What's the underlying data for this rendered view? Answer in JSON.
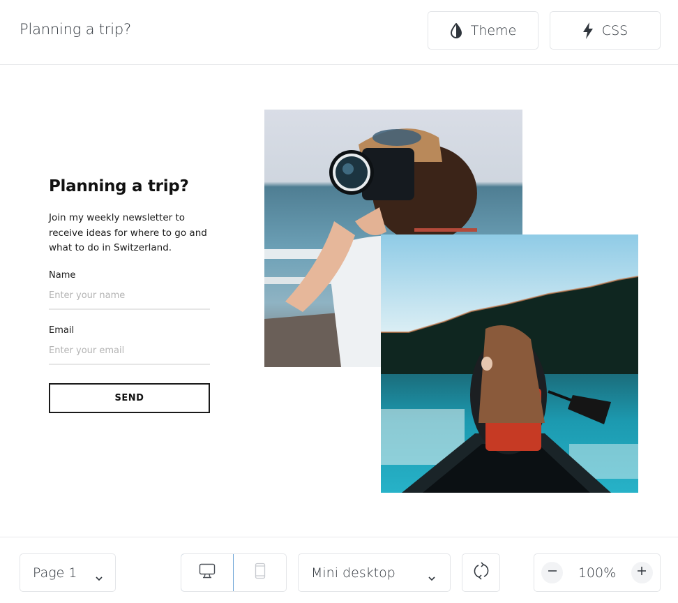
{
  "topbar": {
    "title": "Planning a trip?",
    "buttons": [
      {
        "label": "Theme",
        "icon": "droplet-half-icon"
      },
      {
        "label": "CSS",
        "icon": "lightning-bolt-icon"
      }
    ]
  },
  "canvas": {
    "form": {
      "heading": "Planning a trip?",
      "description": "Join my weekly newsletter to receive ideas for where to go and what to do in Switzerland.",
      "fields": [
        {
          "label": "Name",
          "placeholder": "Enter your name",
          "value": ""
        },
        {
          "label": "Email",
          "placeholder": "Enter your email",
          "value": ""
        }
      ],
      "submit_label": "SEND"
    },
    "photos": [
      {
        "alt": "Person with cap photographing with a camera by a lake"
      },
      {
        "alt": "Woman in red life vest paddling a canoe on a turquoise lake"
      }
    ]
  },
  "bottombar": {
    "page_select": {
      "selected": "Page 1"
    },
    "device_toggle": {
      "options": [
        "desktop",
        "mobile"
      ],
      "active": "desktop"
    },
    "viewport_select": {
      "selected": "Mini desktop"
    },
    "rotate_icon": "rotate-icon",
    "zoom": {
      "value": "100%",
      "decrease_icon": "minus-icon",
      "increase_icon": "plus-icon"
    }
  },
  "colors": {
    "border": "#e3e5e8",
    "active_border": "#6aa3d6",
    "text": "#2f353c",
    "placeholder": "#b3b3b3"
  }
}
